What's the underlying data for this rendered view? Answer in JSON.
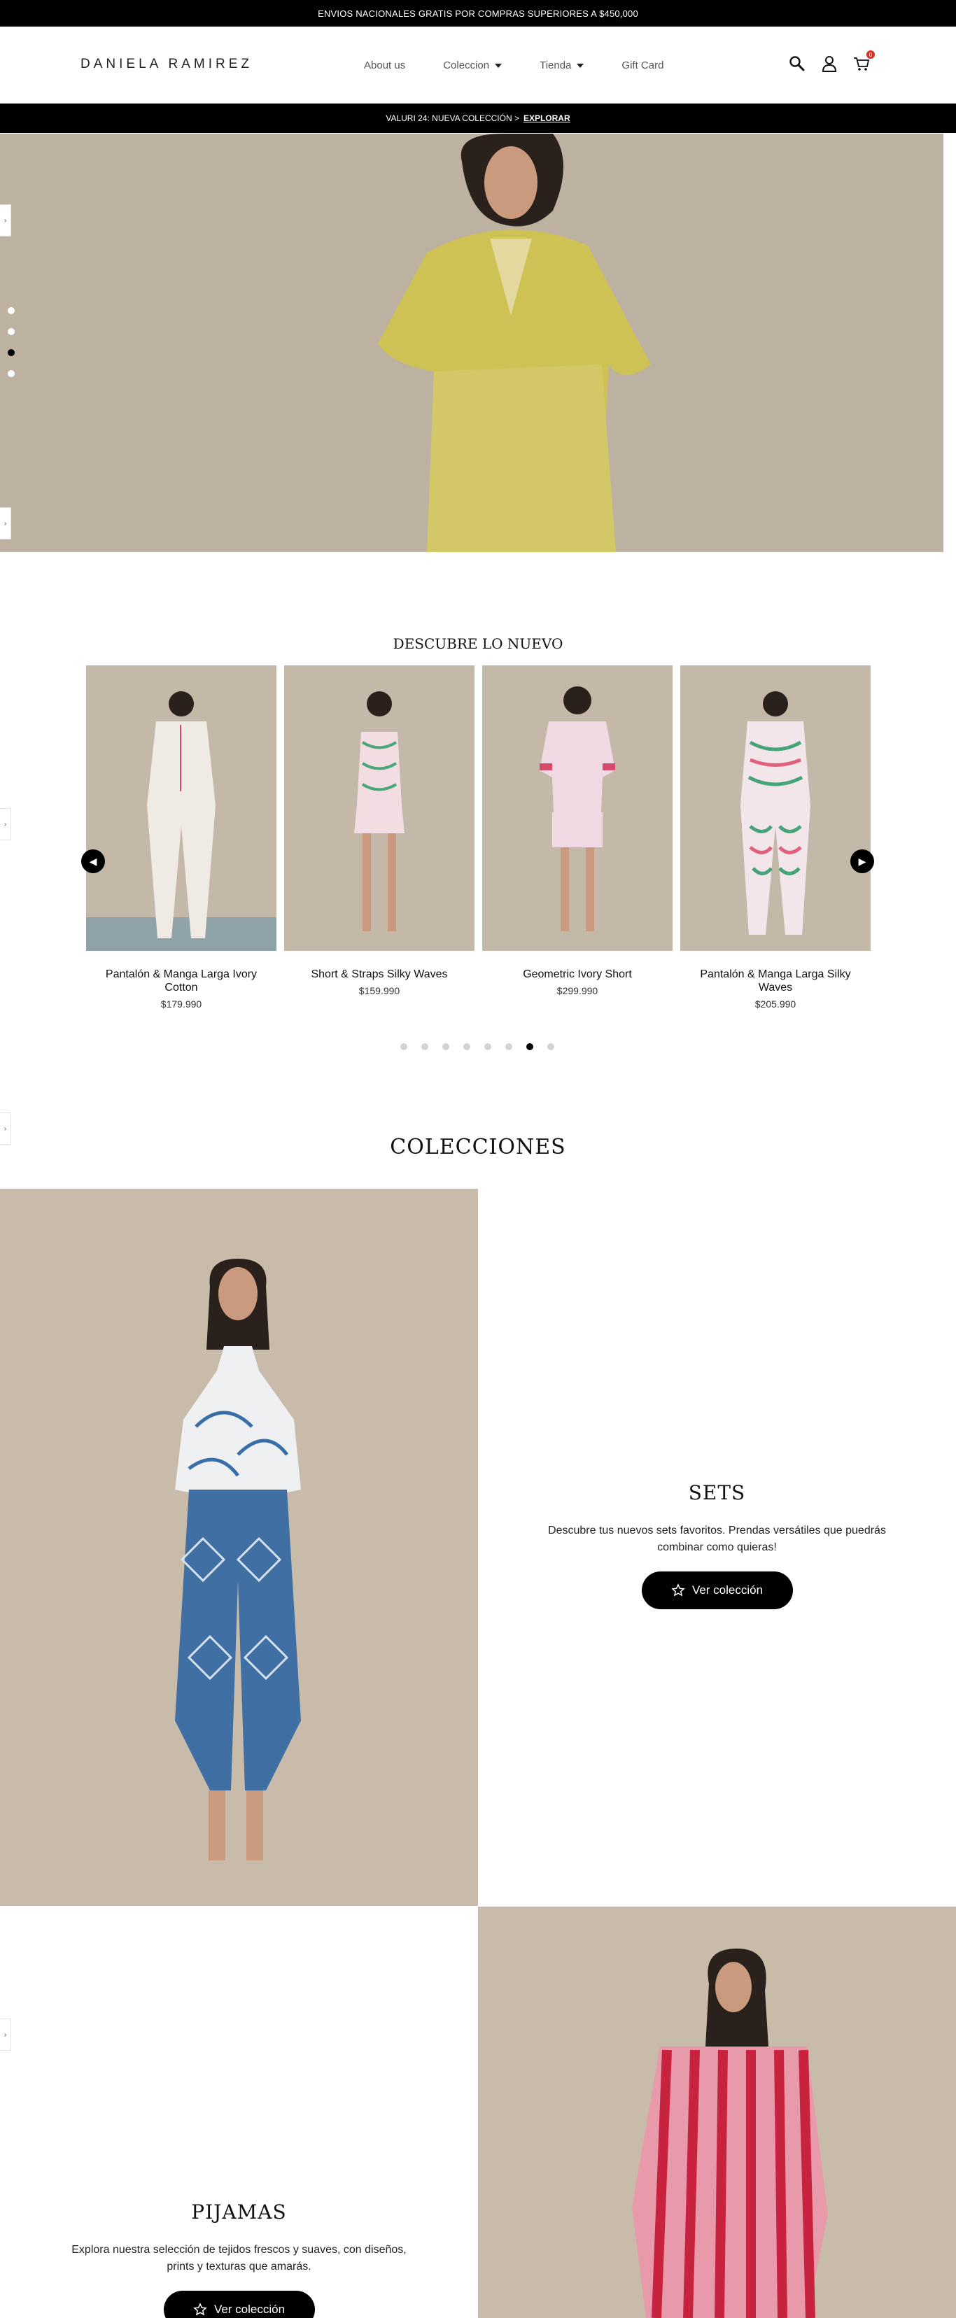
{
  "topbar": {
    "text": "ENVIOS NACIONALES GRATIS POR COMPRAS SUPERIORES A $450,000"
  },
  "header": {
    "logo": "DANIELA RAMIREZ",
    "nav": [
      {
        "label": "About us",
        "has_caret": false
      },
      {
        "label": "Coleccion",
        "has_caret": true
      },
      {
        "label": "Tienda",
        "has_caret": true
      },
      {
        "label": "Gift Card",
        "has_caret": false
      }
    ],
    "icons": [
      "search-icon",
      "user-icon",
      "cart-icon"
    ],
    "cart_count": "0"
  },
  "announcement": {
    "text": "VALURI 24: NUEVA COLECCIÓN >",
    "link": "EXPLORAR"
  },
  "hero": {
    "slide_count": 4,
    "active_slide": 3
  },
  "new_section": {
    "title": "DESCUBRE LO NUEVO",
    "products": [
      {
        "name": "Pantalón & Manga Larga Ivory Cotton",
        "price": "$179.990"
      },
      {
        "name": "Short & Straps Silky Waves",
        "price": "$159.990"
      },
      {
        "name": "Geometric Ivory Short",
        "price": "$299.990"
      },
      {
        "name": "Pantalón & Manga Larga Silky Waves",
        "price": "$205.990"
      }
    ],
    "dot_count": 8,
    "active_dot": 7
  },
  "collections": {
    "title": "COLECCIONES",
    "items": [
      {
        "title": "SETS",
        "description_line1": "Descubre tus nuevos sets favoritos. Prendas versátiles que puedrás",
        "description_line2": "combinar como quieras!",
        "button": "Ver colección"
      },
      {
        "title": "PIJAMAS",
        "description_line1": "Explora nuestra selección de tejidos frescos y suaves, con diseños,",
        "description_line2": "prints y texturas que amarás.",
        "button": "Ver colección"
      }
    ]
  },
  "colors": {
    "black": "#000000",
    "accent_red": "#d93025",
    "photo_bg": "#c4b8a8"
  }
}
